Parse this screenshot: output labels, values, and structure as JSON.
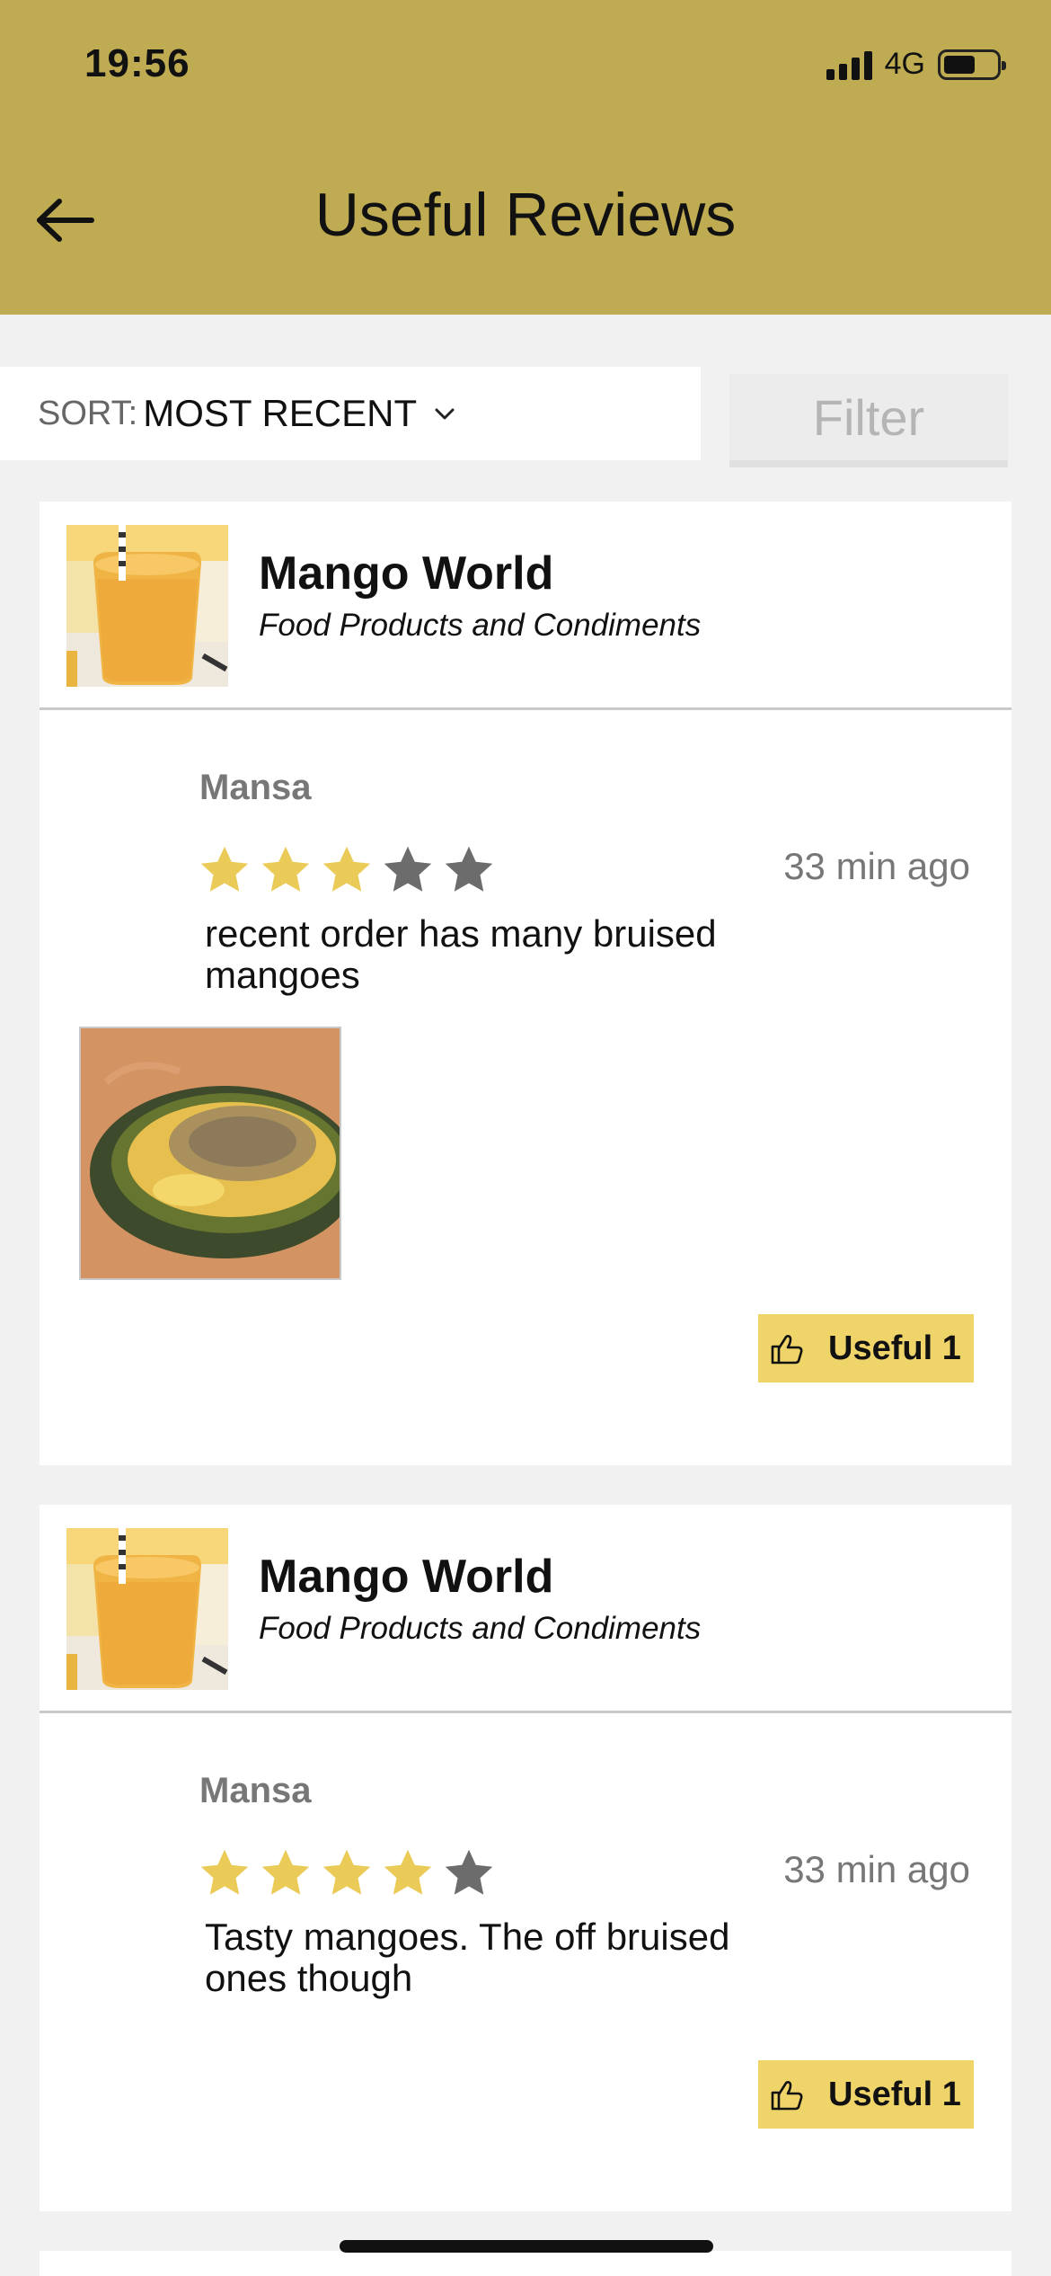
{
  "status_bar": {
    "time": "19:56",
    "network": "4G"
  },
  "header": {
    "title": "Useful Reviews",
    "background_color": "#bfac52",
    "back_icon": "back-arrow-icon"
  },
  "sort": {
    "label": "SORT:",
    "value": "MOST RECENT",
    "icon": "chevron-down-icon"
  },
  "filter": {
    "label": "Filter"
  },
  "reviews": [
    {
      "business": {
        "name": "Mango World",
        "category": "Food Products and Condiments"
      },
      "reviewer": "Mansa",
      "rating": 3,
      "rating_max": 5,
      "time": "33 min ago",
      "text": "recent order has many bruised mangoes",
      "has_photo": true,
      "useful_label": "Useful 1"
    },
    {
      "business": {
        "name": "Mango World",
        "category": "Food Products and Condiments"
      },
      "reviewer": "Mansa",
      "rating": 4,
      "rating_max": 5,
      "time": "33 min ago",
      "text": "Tasty mangoes. The off bruised ones though",
      "has_photo": false,
      "useful_label": "Useful 1"
    }
  ],
  "colors": {
    "star_filled": "#ebcb58",
    "star_empty": "#6c6c6c",
    "useful_button": "#efd46a"
  }
}
